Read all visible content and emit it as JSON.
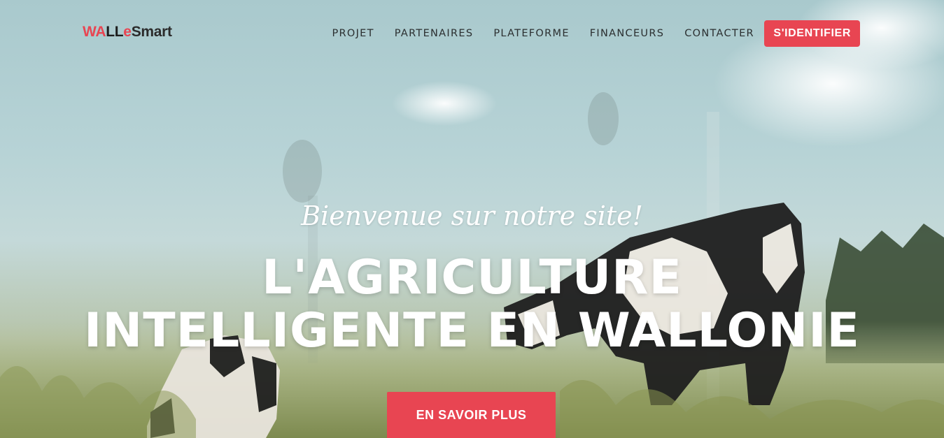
{
  "brand": {
    "part1": "WA",
    "part2": "LL",
    "part3": "e",
    "part4": "Smart"
  },
  "nav": {
    "items": [
      {
        "label": "PROJET"
      },
      {
        "label": "PARTENAIRES"
      },
      {
        "label": "PLATEFORME"
      },
      {
        "label": "FINANCEURS"
      },
      {
        "label": "CONTACTER"
      }
    ],
    "login_label": "S'IDENTIFIER"
  },
  "hero": {
    "subtitle": "Bienvenue sur notre site!",
    "title_line1": "L'AGRICULTURE",
    "title_line2": "INTELLIGENTE EN WALLONIE",
    "cta_label": "EN SAVOIR PLUS"
  },
  "colors": {
    "accent": "#e84552",
    "nav_text": "#2b2f30",
    "hero_text": "#ffffff"
  }
}
